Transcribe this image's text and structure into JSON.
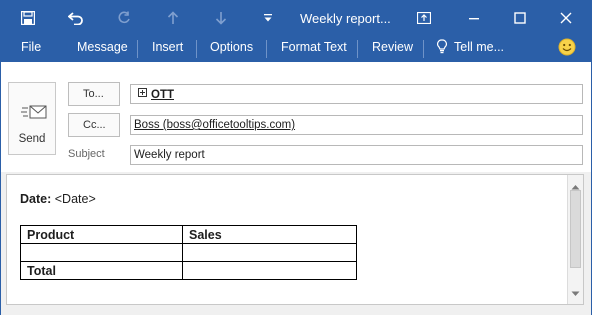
{
  "window": {
    "title": "Weekly report..."
  },
  "ribbon": {
    "file": "File",
    "message": "Message",
    "insert": "Insert",
    "options": "Options",
    "format_text": "Format Text",
    "review": "Review",
    "tell_me": "Tell me..."
  },
  "compose": {
    "send_label": "Send",
    "to_button": "To...",
    "cc_button": "Cc...",
    "subject_label": "Subject",
    "to_value": "OTT",
    "cc_value": "Boss (boss@officetooltips.com)",
    "subject_value": "Weekly report"
  },
  "body": {
    "date_label": "Date:",
    "date_value": "<Date>",
    "table": {
      "headers": [
        "Product",
        "Sales"
      ],
      "rows": [
        [
          "",
          ""
        ]
      ],
      "total_label": "Total"
    }
  },
  "colors": {
    "titlebar": "#2b5fa8",
    "window_bg": "#f0f0f0"
  }
}
